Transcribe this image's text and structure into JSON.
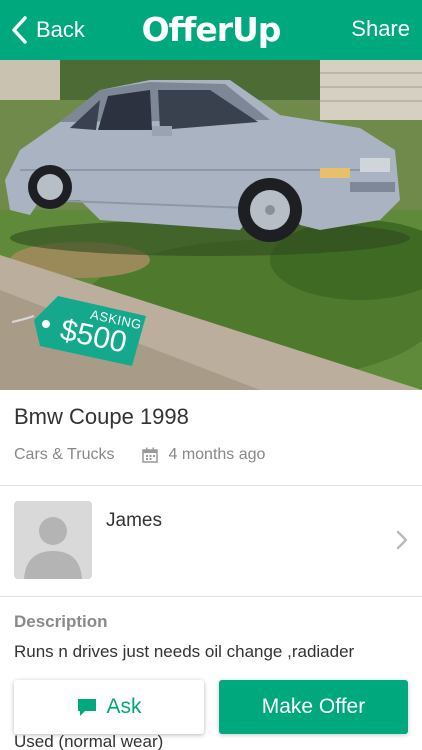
{
  "nav": {
    "back_label": "Back",
    "logo": "OfferUp",
    "share_label": "Share"
  },
  "listing": {
    "price_tag_label": "ASKING",
    "price": "$500",
    "title": "Bmw Coupe 1998",
    "category": "Cars & Trucks",
    "posted": "4 months ago"
  },
  "seller": {
    "name": "James"
  },
  "description": {
    "heading": "Description",
    "text": "Runs n drives just needs oil change ,radiader",
    "condition": "Used (normal wear)"
  },
  "actions": {
    "ask_label": "Ask",
    "offer_label": "Make Offer"
  },
  "colors": {
    "brand": "#00a87e",
    "tag": "#14a98d"
  }
}
